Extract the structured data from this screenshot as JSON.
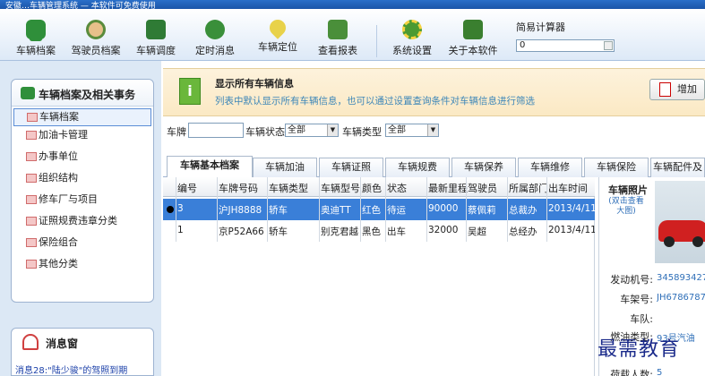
{
  "window": {
    "title": "安徽…车辆管理系统 — 本软件可免费使用"
  },
  "toolbar": {
    "buttons": [
      {
        "label": "车辆档案",
        "icon": "car-icon"
      },
      {
        "label": "驾驶员档案",
        "icon": "driver-icon"
      },
      {
        "label": "车辆调度",
        "icon": "dispatch-icon"
      },
      {
        "label": "定时消息",
        "icon": "message-icon"
      },
      {
        "label": "车辆定位",
        "icon": "location-pin-icon"
      },
      {
        "label": "查看报表",
        "icon": "report-icon"
      },
      {
        "label": "系统设置",
        "icon": "gear-icon"
      },
      {
        "label": "关于本软件",
        "icon": "about-icon"
      }
    ]
  },
  "calculator": {
    "title": "简易计算器",
    "value": "0"
  },
  "sidebar": {
    "title": "车辆档案及相关事务",
    "items": [
      {
        "label": "车辆档案",
        "selected": true
      },
      {
        "label": "加油卡管理"
      },
      {
        "label": "办事单位"
      },
      {
        "label": "组织结构"
      },
      {
        "label": "修车厂与项目"
      },
      {
        "label": "证照规费违章分类"
      },
      {
        "label": "保险组合"
      },
      {
        "label": "其他分类"
      }
    ],
    "message_title": "消息窗",
    "message_line": "消息28:\"陆少骏\"的驾照到期"
  },
  "banner": {
    "icon_text": "i",
    "title": "显示所有车辆信息",
    "description": "列表中默认显示所有车辆信息，也可以通过设置查询条件对车辆信息进行筛选",
    "add_label": "增加"
  },
  "filter": {
    "plate_label": "车牌",
    "plate_value": "",
    "status_label": "车辆状态",
    "status_value": "全部",
    "type_label": "车辆类型",
    "type_value": "全部"
  },
  "tabs": [
    "车辆基本档案",
    "车辆加油",
    "车辆证照",
    "车辆规费",
    "车辆保养",
    "车辆维修",
    "车辆保险",
    "车辆配件及"
  ],
  "table": {
    "columns": [
      "编号",
      "车牌号码",
      "车辆类型",
      "车辆型号",
      "颜色",
      "状态",
      "最新里程",
      "驾驶员",
      "所属部门",
      "出车时间"
    ],
    "rows": [
      [
        "3",
        "沪JH8888",
        "轿车",
        "奥迪TT",
        "红色",
        "待运",
        "90000",
        "蔡佩莉",
        "总裁办",
        "2013/4/11"
      ],
      [
        "1",
        "京P52A66",
        "轿车",
        "别克君越",
        "黑色",
        "出车",
        "32000",
        "吴超",
        "总经办",
        "2013/4/11"
      ]
    ]
  },
  "detail": {
    "title": "车辆照片",
    "photo_link": "(双击查看大图)",
    "fields": [
      {
        "label": "发动机号:",
        "value": "3458934275"
      },
      {
        "label": "车架号:",
        "value": "JH67867876"
      },
      {
        "label": "车队:",
        "value": ""
      },
      {
        "label": "燃油类型:",
        "value": "93号汽油"
      },
      {
        "label": "荷载人数:",
        "value": "5"
      }
    ]
  },
  "watermark": "最需教育",
  "colors": {
    "selection": "#3a7fd8",
    "banner_bg": "#fbe9c4",
    "link": "#2f6fb8",
    "sidebar_bg": "#dce8f5"
  }
}
